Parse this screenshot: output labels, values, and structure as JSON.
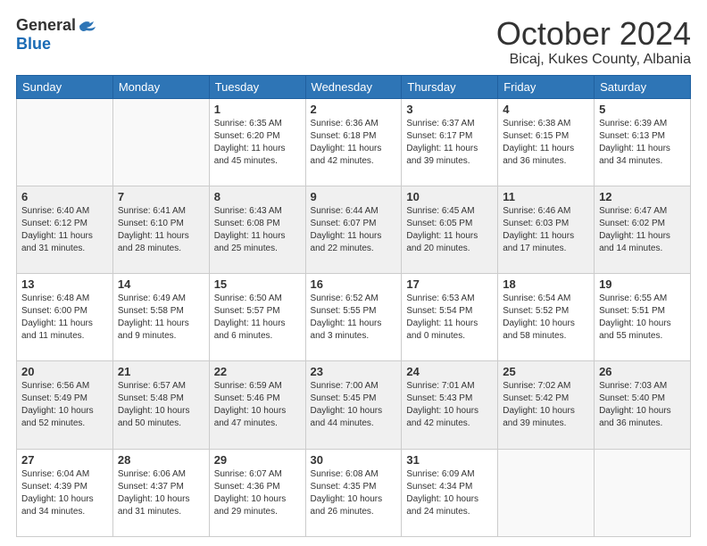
{
  "logo": {
    "general": "General",
    "blue": "Blue"
  },
  "header": {
    "month": "October 2024",
    "location": "Bicaj, Kukes County, Albania"
  },
  "weekdays": [
    "Sunday",
    "Monday",
    "Tuesday",
    "Wednesday",
    "Thursday",
    "Friday",
    "Saturday"
  ],
  "weeks": [
    [
      {
        "day": "",
        "empty": true
      },
      {
        "day": "",
        "empty": true
      },
      {
        "day": "1",
        "sunrise": "Sunrise: 6:35 AM",
        "sunset": "Sunset: 6:20 PM",
        "daylight": "Daylight: 11 hours and 45 minutes."
      },
      {
        "day": "2",
        "sunrise": "Sunrise: 6:36 AM",
        "sunset": "Sunset: 6:18 PM",
        "daylight": "Daylight: 11 hours and 42 minutes."
      },
      {
        "day": "3",
        "sunrise": "Sunrise: 6:37 AM",
        "sunset": "Sunset: 6:17 PM",
        "daylight": "Daylight: 11 hours and 39 minutes."
      },
      {
        "day": "4",
        "sunrise": "Sunrise: 6:38 AM",
        "sunset": "Sunset: 6:15 PM",
        "daylight": "Daylight: 11 hours and 36 minutes."
      },
      {
        "day": "5",
        "sunrise": "Sunrise: 6:39 AM",
        "sunset": "Sunset: 6:13 PM",
        "daylight": "Daylight: 11 hours and 34 minutes."
      }
    ],
    [
      {
        "day": "6",
        "sunrise": "Sunrise: 6:40 AM",
        "sunset": "Sunset: 6:12 PM",
        "daylight": "Daylight: 11 hours and 31 minutes."
      },
      {
        "day": "7",
        "sunrise": "Sunrise: 6:41 AM",
        "sunset": "Sunset: 6:10 PM",
        "daylight": "Daylight: 11 hours and 28 minutes."
      },
      {
        "day": "8",
        "sunrise": "Sunrise: 6:43 AM",
        "sunset": "Sunset: 6:08 PM",
        "daylight": "Daylight: 11 hours and 25 minutes."
      },
      {
        "day": "9",
        "sunrise": "Sunrise: 6:44 AM",
        "sunset": "Sunset: 6:07 PM",
        "daylight": "Daylight: 11 hours and 22 minutes."
      },
      {
        "day": "10",
        "sunrise": "Sunrise: 6:45 AM",
        "sunset": "Sunset: 6:05 PM",
        "daylight": "Daylight: 11 hours and 20 minutes."
      },
      {
        "day": "11",
        "sunrise": "Sunrise: 6:46 AM",
        "sunset": "Sunset: 6:03 PM",
        "daylight": "Daylight: 11 hours and 17 minutes."
      },
      {
        "day": "12",
        "sunrise": "Sunrise: 6:47 AM",
        "sunset": "Sunset: 6:02 PM",
        "daylight": "Daylight: 11 hours and 14 minutes."
      }
    ],
    [
      {
        "day": "13",
        "sunrise": "Sunrise: 6:48 AM",
        "sunset": "Sunset: 6:00 PM",
        "daylight": "Daylight: 11 hours and 11 minutes."
      },
      {
        "day": "14",
        "sunrise": "Sunrise: 6:49 AM",
        "sunset": "Sunset: 5:58 PM",
        "daylight": "Daylight: 11 hours and 9 minutes."
      },
      {
        "day": "15",
        "sunrise": "Sunrise: 6:50 AM",
        "sunset": "Sunset: 5:57 PM",
        "daylight": "Daylight: 11 hours and 6 minutes."
      },
      {
        "day": "16",
        "sunrise": "Sunrise: 6:52 AM",
        "sunset": "Sunset: 5:55 PM",
        "daylight": "Daylight: 11 hours and 3 minutes."
      },
      {
        "day": "17",
        "sunrise": "Sunrise: 6:53 AM",
        "sunset": "Sunset: 5:54 PM",
        "daylight": "Daylight: 11 hours and 0 minutes."
      },
      {
        "day": "18",
        "sunrise": "Sunrise: 6:54 AM",
        "sunset": "Sunset: 5:52 PM",
        "daylight": "Daylight: 10 hours and 58 minutes."
      },
      {
        "day": "19",
        "sunrise": "Sunrise: 6:55 AM",
        "sunset": "Sunset: 5:51 PM",
        "daylight": "Daylight: 10 hours and 55 minutes."
      }
    ],
    [
      {
        "day": "20",
        "sunrise": "Sunrise: 6:56 AM",
        "sunset": "Sunset: 5:49 PM",
        "daylight": "Daylight: 10 hours and 52 minutes."
      },
      {
        "day": "21",
        "sunrise": "Sunrise: 6:57 AM",
        "sunset": "Sunset: 5:48 PM",
        "daylight": "Daylight: 10 hours and 50 minutes."
      },
      {
        "day": "22",
        "sunrise": "Sunrise: 6:59 AM",
        "sunset": "Sunset: 5:46 PM",
        "daylight": "Daylight: 10 hours and 47 minutes."
      },
      {
        "day": "23",
        "sunrise": "Sunrise: 7:00 AM",
        "sunset": "Sunset: 5:45 PM",
        "daylight": "Daylight: 10 hours and 44 minutes."
      },
      {
        "day": "24",
        "sunrise": "Sunrise: 7:01 AM",
        "sunset": "Sunset: 5:43 PM",
        "daylight": "Daylight: 10 hours and 42 minutes."
      },
      {
        "day": "25",
        "sunrise": "Sunrise: 7:02 AM",
        "sunset": "Sunset: 5:42 PM",
        "daylight": "Daylight: 10 hours and 39 minutes."
      },
      {
        "day": "26",
        "sunrise": "Sunrise: 7:03 AM",
        "sunset": "Sunset: 5:40 PM",
        "daylight": "Daylight: 10 hours and 36 minutes."
      }
    ],
    [
      {
        "day": "27",
        "sunrise": "Sunrise: 6:04 AM",
        "sunset": "Sunset: 4:39 PM",
        "daylight": "Daylight: 10 hours and 34 minutes."
      },
      {
        "day": "28",
        "sunrise": "Sunrise: 6:06 AM",
        "sunset": "Sunset: 4:37 PM",
        "daylight": "Daylight: 10 hours and 31 minutes."
      },
      {
        "day": "29",
        "sunrise": "Sunrise: 6:07 AM",
        "sunset": "Sunset: 4:36 PM",
        "daylight": "Daylight: 10 hours and 29 minutes."
      },
      {
        "day": "30",
        "sunrise": "Sunrise: 6:08 AM",
        "sunset": "Sunset: 4:35 PM",
        "daylight": "Daylight: 10 hours and 26 minutes."
      },
      {
        "day": "31",
        "sunrise": "Sunrise: 6:09 AM",
        "sunset": "Sunset: 4:34 PM",
        "daylight": "Daylight: 10 hours and 24 minutes."
      },
      {
        "day": "",
        "empty": true
      },
      {
        "day": "",
        "empty": true
      }
    ]
  ]
}
